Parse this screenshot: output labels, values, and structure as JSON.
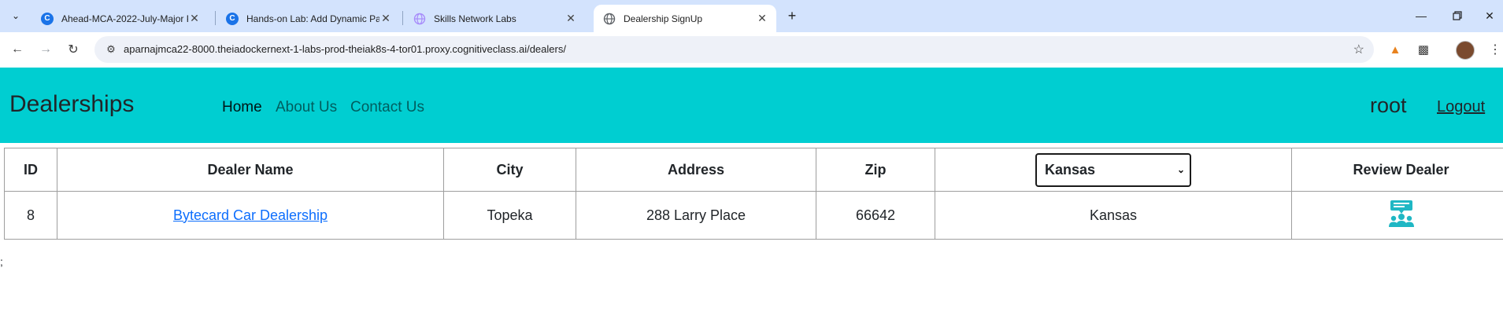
{
  "browser": {
    "tabs": [
      {
        "title": "Ahead-MCA-2022-July-Major P",
        "favicon": "C",
        "favicon_color": "#1a73e8",
        "active": false
      },
      {
        "title": "Hands-on Lab: Add Dynamic Pa",
        "favicon": "C",
        "favicon_color": "#1a73e8",
        "active": false
      },
      {
        "title": "Skills Network Labs",
        "favicon": "globe-icon",
        "favicon_color": "#a78bfa",
        "active": false
      },
      {
        "title": "Dealership SignUp",
        "favicon": "globe-icon",
        "favicon_color": "#5f6368",
        "active": true
      }
    ],
    "url": "aparnajmca22-8000.theiadockernext-1-labs-prod-theiak8s-4-tor01.proxy.cognitiveclass.ai/dealers/"
  },
  "navbar": {
    "brand": "Dealerships",
    "links": [
      {
        "label": "Home",
        "active": true
      },
      {
        "label": "About Us",
        "active": false
      },
      {
        "label": "Contact Us",
        "active": false
      }
    ],
    "username": "root",
    "logout_label": "Logout",
    "background_color": "#00ced1"
  },
  "table": {
    "headers": {
      "id": "ID",
      "dealer_name": "Dealer Name",
      "city": "City",
      "address": "Address",
      "zip": "Zip",
      "review": "Review Dealer"
    },
    "state_filter": {
      "selected": "Kansas"
    },
    "rows": [
      {
        "id": "8",
        "dealer_name": "Bytecard Car Dealership",
        "city": "Topeka",
        "address": "288 Larry Place",
        "zip": "66642",
        "state": "Kansas",
        "review_icon": "review-dealer-icon"
      }
    ]
  },
  "stray_text": ";"
}
